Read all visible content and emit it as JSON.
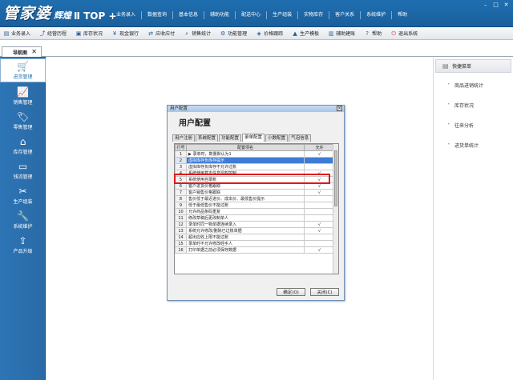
{
  "app": {
    "logo_main": "管家婆",
    "logo_sub": "辉煌",
    "logo_version": "Ⅱ TOP +"
  },
  "top_menu": [
    "业务录入",
    "数据查询",
    "基本信息",
    "辅助功能",
    "配送中心",
    "生产组装",
    "实物库存",
    "客户关系",
    "系统维护",
    "帮助"
  ],
  "toolbar": [
    {
      "icon": "doc-icon",
      "label": "业务录入"
    },
    {
      "icon": "chart-icon",
      "label": "经营历程"
    },
    {
      "icon": "box-icon",
      "label": "库存状况"
    },
    {
      "icon": "cash-icon",
      "label": "现金银行"
    },
    {
      "icon": "pay-icon",
      "label": "应收应付"
    },
    {
      "icon": "search-icon",
      "label": "销售统计"
    },
    {
      "icon": "gear-icon",
      "label": "功能管理"
    },
    {
      "icon": "tag-icon",
      "label": "价格跟踪"
    },
    {
      "icon": "build-icon",
      "label": "生产模板"
    },
    {
      "icon": "book-icon",
      "label": "辅助建账"
    },
    {
      "icon": "help-icon",
      "label": "帮助"
    },
    {
      "icon": "exit-icon",
      "label": "退出系统"
    }
  ],
  "tab": {
    "label": "导航图",
    "close": "✕"
  },
  "sidebar": [
    {
      "label": "进货管理",
      "icon": "cart-icon",
      "active": true
    },
    {
      "label": "销售管理",
      "icon": "trend-icon"
    },
    {
      "label": "零售管理",
      "icon": "tag-icon"
    },
    {
      "label": "库存管理",
      "icon": "warehouse-icon"
    },
    {
      "label": "钱流管理",
      "icon": "money-icon"
    },
    {
      "label": "生产组装",
      "icon": "tools-icon"
    },
    {
      "label": "系统维护",
      "icon": "wrench-icon"
    },
    {
      "label": "产品升级",
      "icon": "upload-icon"
    }
  ],
  "quick_menu": {
    "title": "快捷菜单",
    "items": [
      "商品进销统计",
      "库存状况",
      "往来分析",
      "进货单统计"
    ]
  },
  "dialog": {
    "title": "用户配置",
    "heading": "用户配置",
    "tabs": [
      "用户注册",
      "系统配置",
      "功能配置",
      "录单配置",
      "小数配置",
      "气泡信息"
    ],
    "active_tab": 3,
    "columns": [
      "行号",
      "配置项名",
      "允许"
    ],
    "rows": [
      {
        "no": "1",
        "name": "录单时，数量默认为1",
        "allow": "√",
        "pointer": true
      },
      {
        "no": "2",
        "name": "虚拟库存负库存提示",
        "allow": "",
        "selected": true
      },
      {
        "no": "3",
        "name": "虚拟库存负库存不允许过账",
        "allow": ""
      },
      {
        "no": "4",
        "name": "系统使用基本信息授权控制",
        "allow": "√"
      },
      {
        "no": "5",
        "name": "系统使用自录账",
        "allow": "√"
      },
      {
        "no": "6",
        "name": "客户进货价格跟踪",
        "allow": "√"
      },
      {
        "no": "7",
        "name": "客户销售价格跟踪",
        "allow": "√"
      },
      {
        "no": "8",
        "name": "售价低于最近进价、成本价、最低售价提示",
        "allow": ""
      },
      {
        "no": "9",
        "name": "低于最低售价不能过账",
        "allow": ""
      },
      {
        "no": "10",
        "name": "允许商品条码重复",
        "allow": ""
      },
      {
        "no": "11",
        "name": "修改草稿后更改制单人",
        "allow": ""
      },
      {
        "no": "12",
        "name": "录单时同一物单据连续录入",
        "allow": "√"
      },
      {
        "no": "13",
        "name": "系统允许修改/删除已过账单据",
        "allow": "√"
      },
      {
        "no": "14",
        "name": "超出应收上限不能过账",
        "allow": ""
      },
      {
        "no": "15",
        "name": "录单时不允许修改经手人",
        "allow": ""
      },
      {
        "no": "16",
        "name": "打印单据之前必须保存数据",
        "allow": "√"
      }
    ],
    "ok_button": "确定(O)",
    "close_button": "关闭(C)"
  }
}
